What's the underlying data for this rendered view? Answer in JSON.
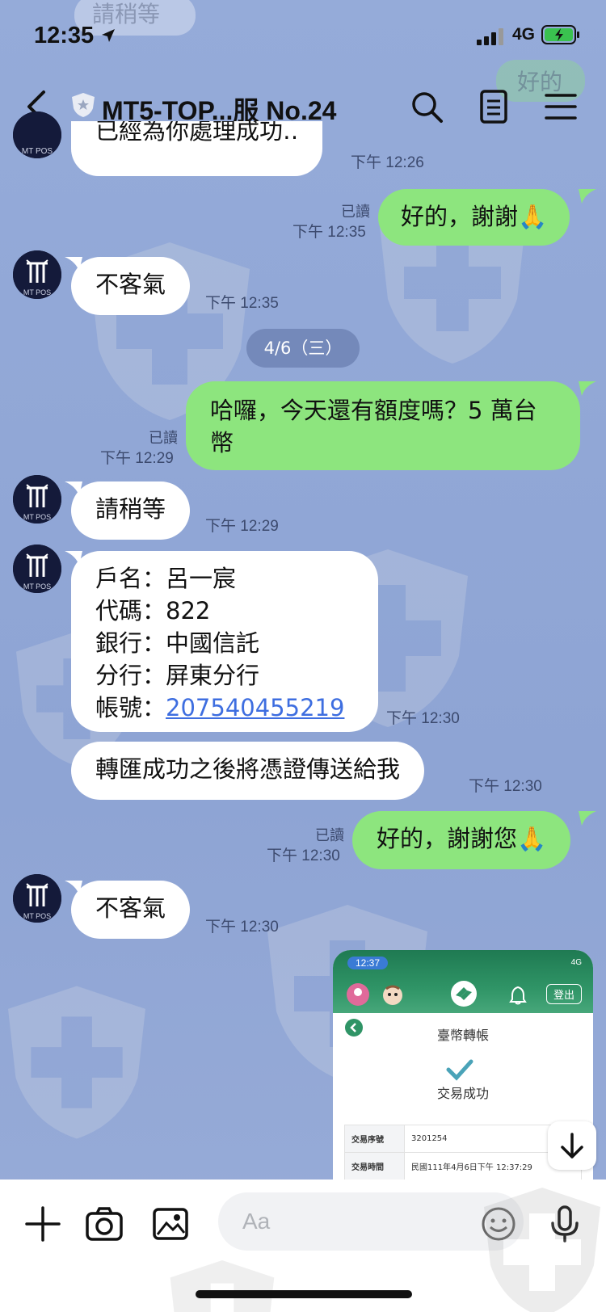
{
  "status_bar": {
    "time": "12:35",
    "network": "4G"
  },
  "header": {
    "title": "MT5-TOP...服 No.24"
  },
  "top_partial": {
    "text": "已經為你處理成功‥",
    "time": "下午 12:26",
    "ghost_top": "請稍等",
    "ghost_right": "好的"
  },
  "messages": [
    {
      "id": "m1",
      "dir": "out",
      "text": "好的，謝謝🙏",
      "read": "已讀",
      "time": "下午 12:35"
    },
    {
      "id": "m2",
      "dir": "in",
      "text": "不客氣",
      "time": "下午 12:35"
    },
    {
      "id": "m3",
      "dir": "out",
      "lines": [
        "哈囉，今天還有額度嗎？5 萬台",
        "幣"
      ],
      "read": "已讀",
      "time": "下午 12:29"
    },
    {
      "id": "m4",
      "dir": "in",
      "text": "請稍等",
      "time": "下午 12:29"
    },
    {
      "id": "m5",
      "dir": "in",
      "account": {
        "name": "戶名：呂一宸",
        "code": "代碼：822",
        "bank": "銀行：中國信託",
        "branch": "分行：屏東分行",
        "number_label": "帳號：",
        "number": "207540455219"
      },
      "time": "下午 12:30"
    },
    {
      "id": "m6",
      "dir": "in",
      "text": "轉匯成功之後將憑證傳送給我",
      "time": "下午 12:30"
    },
    {
      "id": "m7",
      "dir": "out",
      "text": "好的，謝謝您🙏",
      "read": "已讀",
      "time": "下午 12:30"
    },
    {
      "id": "m8",
      "dir": "in",
      "text": "不客氣",
      "time": "下午 12:30"
    }
  ],
  "date_divider": "4/6（三）",
  "image_message": {
    "time": "12:37",
    "network": "4G",
    "logout": "登出",
    "title": "臺幣轉帳",
    "status": "交易成功",
    "rows": [
      {
        "key": "交易序號",
        "value": "3201254"
      },
      {
        "key": "交易時間",
        "value": "民國111年4月6日下午 12:37:29"
      }
    ]
  },
  "input": {
    "placeholder": "Aa"
  },
  "colors": {
    "background": "#8fa6d6",
    "outgoing": "#8de57e",
    "incoming": "#ffffff",
    "link": "#3e6ee0"
  },
  "icons": [
    "back-icon",
    "search-icon",
    "notes-icon",
    "menu-icon",
    "plus-icon",
    "camera-icon",
    "image-icon",
    "emoji-icon",
    "mic-icon",
    "arrow-down-icon"
  ]
}
